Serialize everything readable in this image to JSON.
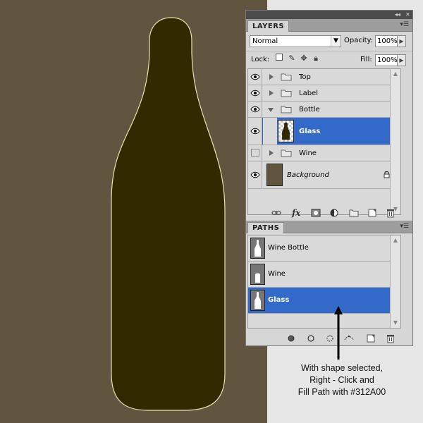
{
  "colors": {
    "canvas_background": "#61553f",
    "bottle_fill": "#312A00",
    "bottle_outline": "#e8e3b0",
    "panel_bg": "#d6d6d6",
    "selection_blue": "#3369c9",
    "dock_titlebar": "#4b4b4b"
  },
  "dock": {
    "collapse_icon": "double-chevron-left-icon",
    "close_icon": "close-x-icon"
  },
  "layers_panel": {
    "tab_label": "LAYERS",
    "menu_icon": "panel-menu-icon",
    "blend_mode": "Normal",
    "opacity_label": "Opacity:",
    "opacity_value": "100%",
    "lock_label": "Lock:",
    "fill_label": "Fill:",
    "fill_value": "100%",
    "layers": [
      {
        "name": "Top",
        "type": "group",
        "visible": true,
        "expanded": false
      },
      {
        "name": "Label",
        "type": "group",
        "visible": true,
        "expanded": false
      },
      {
        "name": "Bottle",
        "type": "group",
        "visible": true,
        "expanded": true
      },
      {
        "name": "Glass",
        "type": "layer",
        "visible": true,
        "selected": true
      },
      {
        "name": "Wine",
        "type": "group",
        "visible": false,
        "expanded": false
      },
      {
        "name": "Background",
        "type": "background",
        "visible": true,
        "locked": true
      }
    ],
    "footer_icons": [
      "link-layers-icon",
      "fx-layer-style-icon",
      "add-mask-icon",
      "adjustment-layer-icon",
      "new-group-icon",
      "new-layer-icon",
      "delete-layer-icon"
    ],
    "fx_label": "fx"
  },
  "paths_panel": {
    "tab_label": "PATHS",
    "paths": [
      {
        "name": "Wine Bottle",
        "selected": false
      },
      {
        "name": "Wine",
        "selected": false
      },
      {
        "name": "Glass",
        "selected": true
      }
    ],
    "footer_icons": [
      "fill-path-icon",
      "stroke-path-icon",
      "load-selection-icon",
      "make-work-path-icon",
      "new-path-icon",
      "delete-path-icon"
    ]
  },
  "annotation": {
    "line1": "With shape selected,",
    "line2": "Right - Click and",
    "line3": "Fill Path with #312A00"
  }
}
